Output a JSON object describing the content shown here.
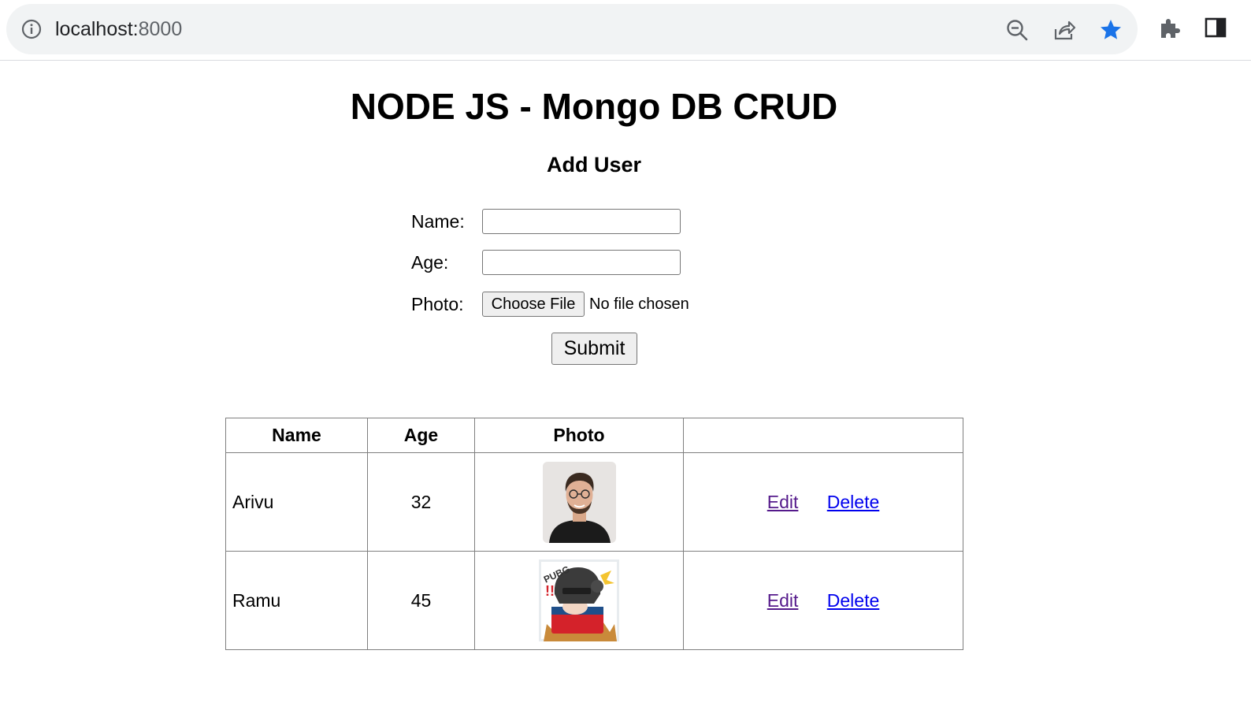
{
  "browser": {
    "url_host": "localhost:",
    "url_port": "8000"
  },
  "page": {
    "title": "NODE JS - Mongo DB CRUD",
    "form": {
      "heading": "Add User",
      "name_label": "Name:",
      "age_label": "Age:",
      "photo_label": "Photo:",
      "choose_file_label": "Choose File",
      "file_status": "No file chosen",
      "submit_label": "Submit"
    },
    "table": {
      "headers": [
        "Name",
        "Age",
        "Photo",
        ""
      ],
      "rows": [
        {
          "name": "Arivu",
          "age": "32",
          "edit": "Edit",
          "delete": "Delete"
        },
        {
          "name": "Ramu",
          "age": "45",
          "edit": "Edit",
          "delete": "Delete"
        }
      ]
    }
  }
}
